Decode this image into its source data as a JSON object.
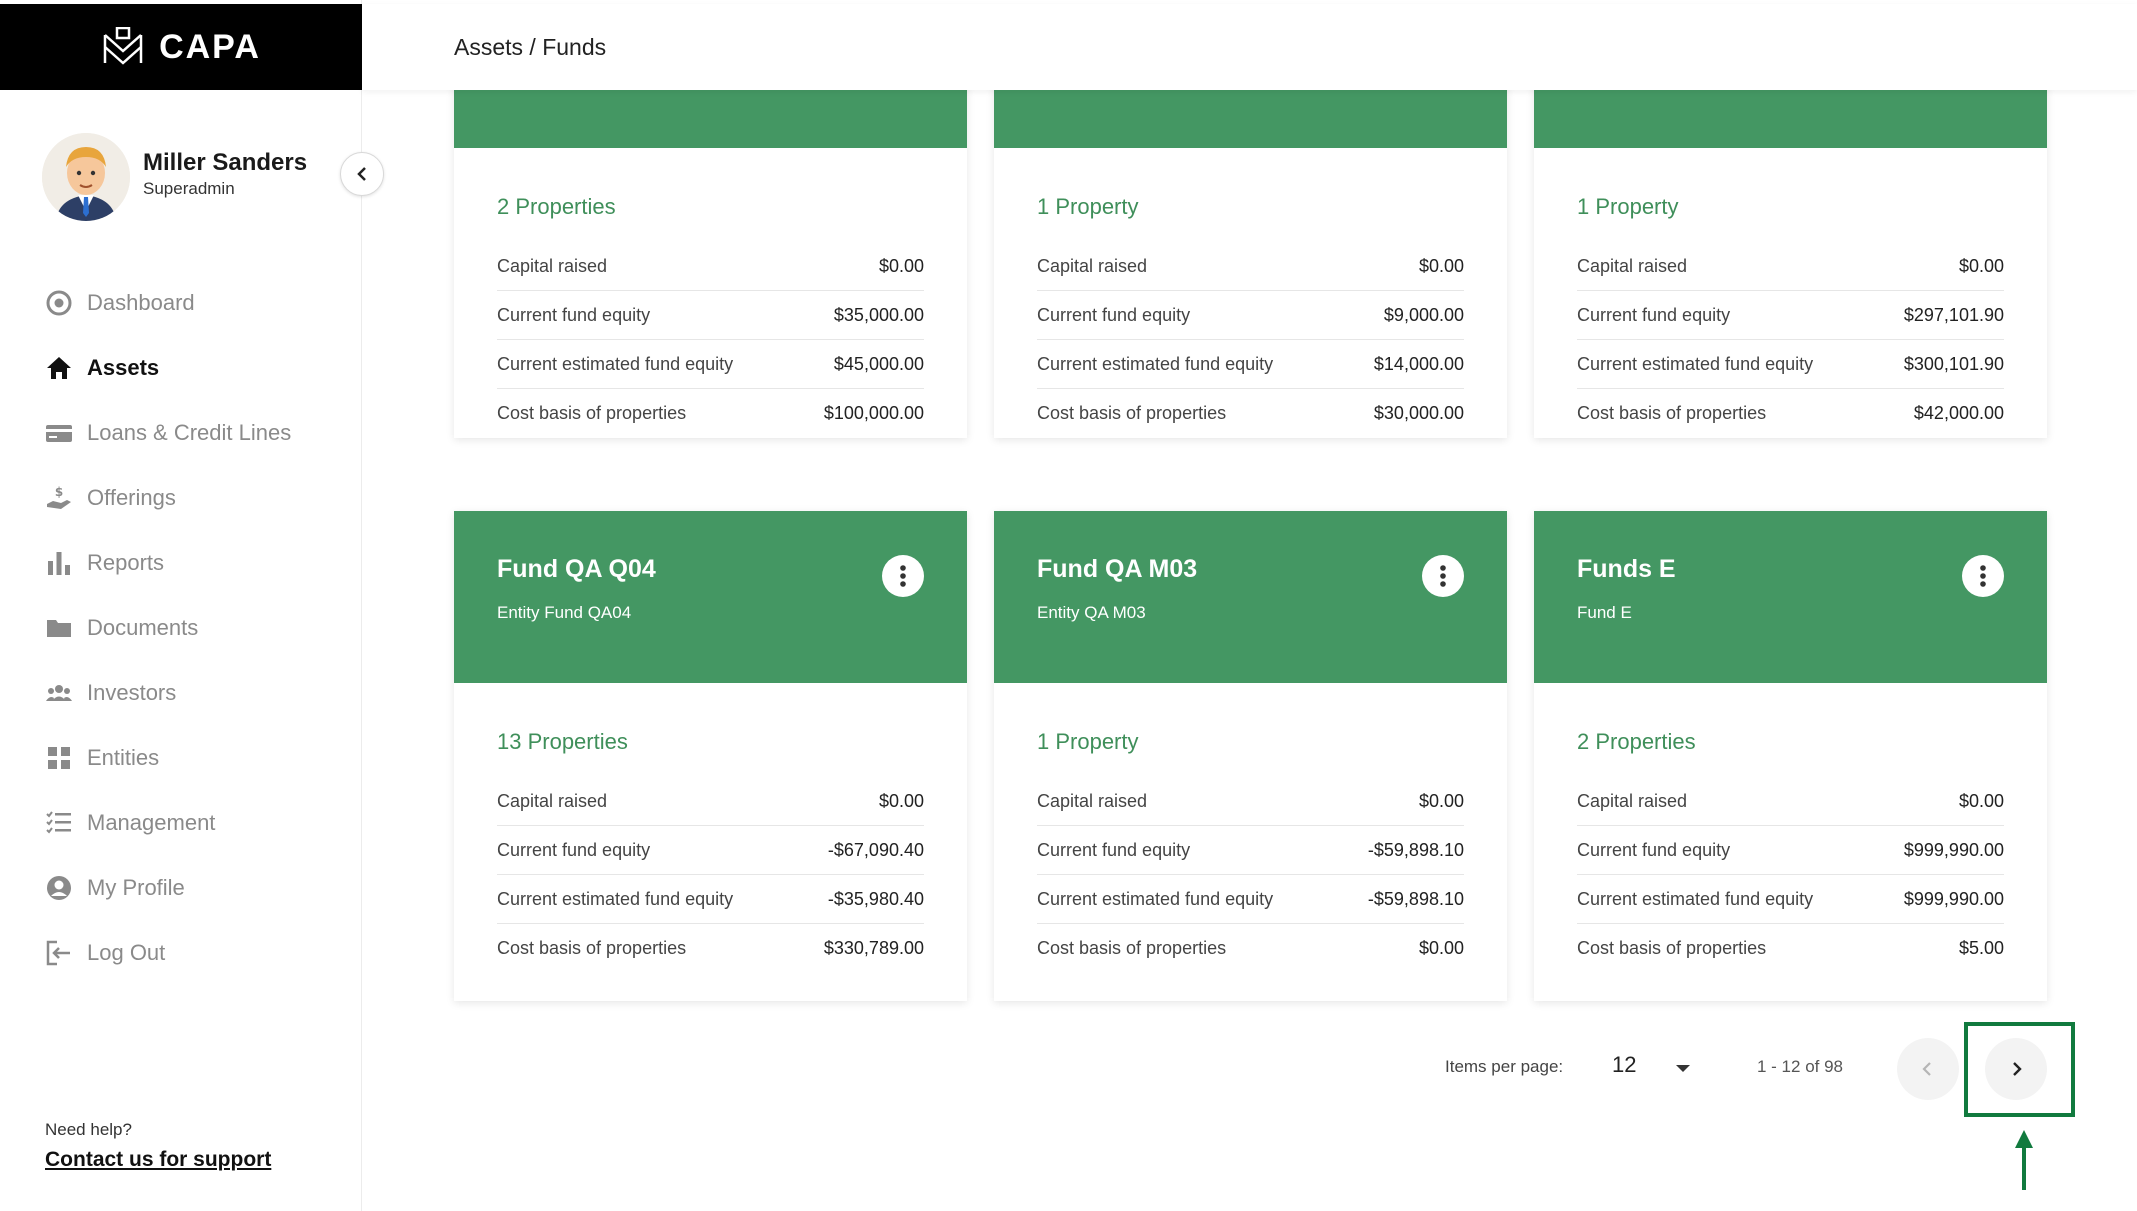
{
  "brand": {
    "name": "CAPA"
  },
  "user": {
    "name": "Miller Sanders",
    "role": "Superadmin"
  },
  "nav": [
    {
      "label": "Dashboard",
      "icon": "dashboard-icon",
      "active": false
    },
    {
      "label": "Assets",
      "icon": "home-icon",
      "active": true
    },
    {
      "label": "Loans & Credit Lines",
      "icon": "credit-card-icon",
      "active": false
    },
    {
      "label": "Offerings",
      "icon": "offering-hand-icon",
      "active": false
    },
    {
      "label": "Reports",
      "icon": "bar-chart-icon",
      "active": false
    },
    {
      "label": "Documents",
      "icon": "folder-icon",
      "active": false
    },
    {
      "label": "Investors",
      "icon": "people-icon",
      "active": false
    },
    {
      "label": "Entities",
      "icon": "grid-icon",
      "active": false
    },
    {
      "label": "Management",
      "icon": "checklist-icon",
      "active": false
    },
    {
      "label": "My Profile",
      "icon": "user-circle-icon",
      "active": false
    },
    {
      "label": "Log Out",
      "icon": "logout-icon",
      "active": false
    }
  ],
  "help": {
    "question": "Need help?",
    "link": "Contact us for support"
  },
  "breadcrumb": "Assets / Funds",
  "colors": {
    "card_header": "#449763",
    "accent_text": "#3f8f5a",
    "annotation": "#117a3e"
  },
  "metric_labels": {
    "capital": "Capital raised",
    "equity": "Current fund equity",
    "est_equity": "Current estimated fund equity",
    "cost": "Cost basis of properties"
  },
  "cards_top": [
    {
      "properties": "2 Properties",
      "capital": "$0.00",
      "equity": "$35,000.00",
      "est_equity": "$45,000.00",
      "cost": "$100,000.00"
    },
    {
      "properties": "1 Property",
      "capital": "$0.00",
      "equity": "$9,000.00",
      "est_equity": "$14,000.00",
      "cost": "$30,000.00"
    },
    {
      "properties": "1 Property",
      "capital": "$0.00",
      "equity": "$297,101.90",
      "est_equity": "$300,101.90",
      "cost": "$42,000.00"
    }
  ],
  "cards_bottom": [
    {
      "title": "Fund QA Q04",
      "subtitle": "Entity Fund QA04",
      "properties": "13 Properties",
      "capital": "$0.00",
      "equity": "-$67,090.40",
      "est_equity": "-$35,980.40",
      "cost": "$330,789.00"
    },
    {
      "title": "Fund QA M03",
      "subtitle": "Entity QA M03",
      "properties": "1 Property",
      "capital": "$0.00",
      "equity": "-$59,898.10",
      "est_equity": "-$59,898.10",
      "cost": "$0.00"
    },
    {
      "title": "Funds E",
      "subtitle": "Fund E",
      "properties": "2 Properties",
      "capital": "$0.00",
      "equity": "$999,990.00",
      "est_equity": "$999,990.00",
      "cost": "$5.00"
    }
  ],
  "pagination": {
    "items_label": "Items per page:",
    "per_page": "12",
    "range": "1 - 12 of 98"
  }
}
